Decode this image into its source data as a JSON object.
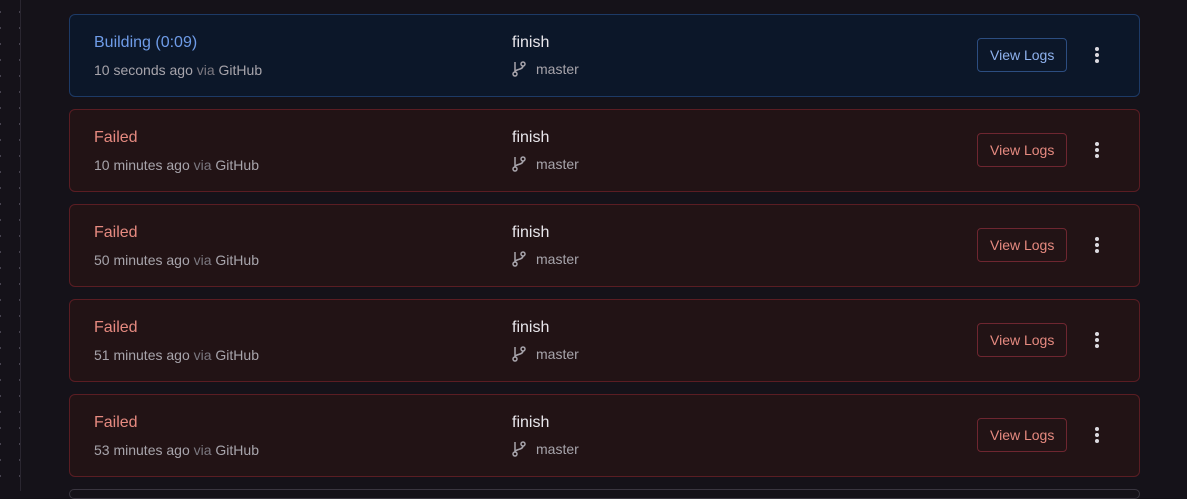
{
  "deployments": [
    {
      "kind": "building",
      "status": "Building (0:09)",
      "time": "10 seconds ago",
      "via": "via",
      "source": "GitHub",
      "commit": "finish",
      "branch": "master",
      "logs_label": "View Logs"
    },
    {
      "kind": "failed",
      "status": "Failed",
      "time": "10 minutes ago",
      "via": "via",
      "source": "GitHub",
      "commit": "finish",
      "branch": "master",
      "logs_label": "View Logs"
    },
    {
      "kind": "failed",
      "status": "Failed",
      "time": "50 minutes ago",
      "via": "via",
      "source": "GitHub",
      "commit": "finish",
      "branch": "master",
      "logs_label": "View Logs"
    },
    {
      "kind": "failed",
      "status": "Failed",
      "time": "51 minutes ago",
      "via": "via",
      "source": "GitHub",
      "commit": "finish",
      "branch": "master",
      "logs_label": "View Logs"
    },
    {
      "kind": "failed",
      "status": "Failed",
      "time": "53 minutes ago",
      "via": "via",
      "source": "GitHub",
      "commit": "finish",
      "branch": "master",
      "logs_label": "View Logs"
    }
  ],
  "icons": {
    "branch": "git-branch-icon",
    "more": "more-vertical-icon"
  },
  "colors": {
    "building_accent": "#6f9ce8",
    "failed_accent": "#e68a80",
    "background": "#151219"
  }
}
